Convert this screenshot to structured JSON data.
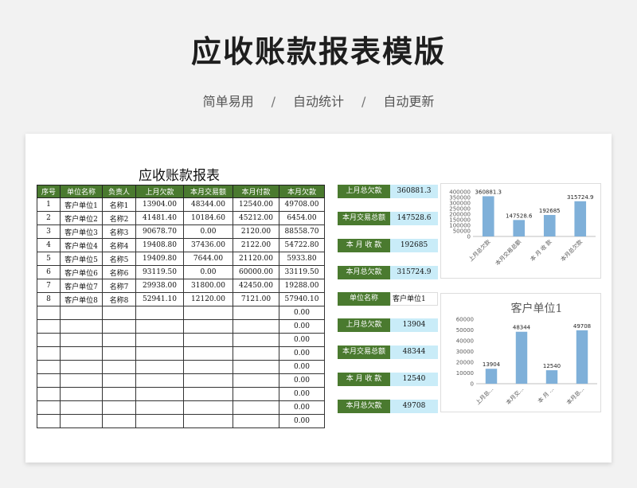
{
  "header": {
    "title": "应收账款报表模版",
    "tags": [
      "简单易用",
      "自动统计",
      "自动更新"
    ],
    "separator": "/"
  },
  "sheet": {
    "title": "应收账款报表",
    "columns": [
      "序号",
      "单位名称",
      "负责人",
      "上月欠款",
      "本月交易额",
      "本月付款",
      "本月欠款"
    ],
    "rows": [
      [
        "1",
        "客户单位1",
        "名称1",
        "13904.00",
        "48344.00",
        "12540.00",
        "49708.00"
      ],
      [
        "2",
        "客户单位2",
        "名称2",
        "41481.40",
        "10184.60",
        "45212.00",
        "6454.00"
      ],
      [
        "3",
        "客户单位3",
        "名称3",
        "90678.70",
        "0.00",
        "2120.00",
        "88558.70"
      ],
      [
        "4",
        "客户单位4",
        "名称4",
        "19408.80",
        "37436.00",
        "2122.00",
        "54722.80"
      ],
      [
        "5",
        "客户单位5",
        "名称5",
        "19409.80",
        "7644.00",
        "21120.00",
        "5933.80"
      ],
      [
        "6",
        "客户单位6",
        "名称6",
        "93119.50",
        "0.00",
        "60000.00",
        "33119.50"
      ],
      [
        "7",
        "客户单位7",
        "名称7",
        "29938.00",
        "31800.00",
        "42450.00",
        "19288.00"
      ],
      [
        "8",
        "客户单位8",
        "名称8",
        "52941.10",
        "12120.00",
        "7121.00",
        "57940.10"
      ],
      [
        "",
        "",
        "",
        "",
        "",
        "",
        "0.00"
      ],
      [
        "",
        "",
        "",
        "",
        "",
        "",
        "0.00"
      ],
      [
        "",
        "",
        "",
        "",
        "",
        "",
        "0.00"
      ],
      [
        "",
        "",
        "",
        "",
        "",
        "",
        "0.00"
      ],
      [
        "",
        "",
        "",
        "",
        "",
        "",
        "0.00"
      ],
      [
        "",
        "",
        "",
        "",
        "",
        "",
        "0.00"
      ],
      [
        "",
        "",
        "",
        "",
        "",
        "",
        "0.00"
      ],
      [
        "",
        "",
        "",
        "",
        "",
        "",
        "0.00"
      ],
      [
        "",
        "",
        "",
        "",
        "",
        "",
        "0.00"
      ]
    ]
  },
  "summary": [
    {
      "label": "上月总欠款",
      "value": "360881.3"
    },
    {
      "label": "本月交易总额",
      "value": "147528.6"
    },
    {
      "label": "本 月 收 款",
      "value": "192685"
    },
    {
      "label": "本月总欠款",
      "value": "315724.9"
    }
  ],
  "unit_panel": {
    "label": "单位名称",
    "value": "客户单位1",
    "items": [
      {
        "label": "上月总欠款",
        "value": "13904"
      },
      {
        "label": "本月交易总额",
        "value": "48344"
      },
      {
        "label": "本 月 收 款",
        "value": "12540"
      },
      {
        "label": "本月总欠款",
        "value": "49708"
      }
    ]
  },
  "colors": {
    "header_green": "#4a7a2f",
    "value_blue": "#c9ecf8",
    "bar_blue": "#7fb0d9"
  },
  "chart_data": [
    {
      "type": "bar",
      "title": "",
      "categories": [
        "上月总欠款",
        "本月交易总额",
        "本 月 收 款",
        "本月总欠款"
      ],
      "values": [
        360881.3,
        147528.6,
        192685,
        315724.9
      ],
      "value_labels": [
        "360881.3",
        "147528.6",
        "192685",
        "315724.9"
      ],
      "ylim": [
        0,
        400000
      ],
      "yticks": [
        "0",
        "50000",
        "100000",
        "150000",
        "200000",
        "250000",
        "300000",
        "350000",
        "400000"
      ],
      "grid": false
    },
    {
      "type": "bar",
      "title": "客户单位1",
      "categories": [
        "上月总...",
        "本月交...",
        "本 月 ...",
        "本月总..."
      ],
      "values": [
        13904,
        48344,
        12540,
        49708
      ],
      "value_labels": [
        "13904",
        "48344",
        "12540",
        "49708"
      ],
      "ylim": [
        0,
        60000
      ],
      "yticks": [
        "0",
        "10000",
        "20000",
        "30000",
        "40000",
        "50000",
        "60000"
      ],
      "grid": false
    }
  ]
}
